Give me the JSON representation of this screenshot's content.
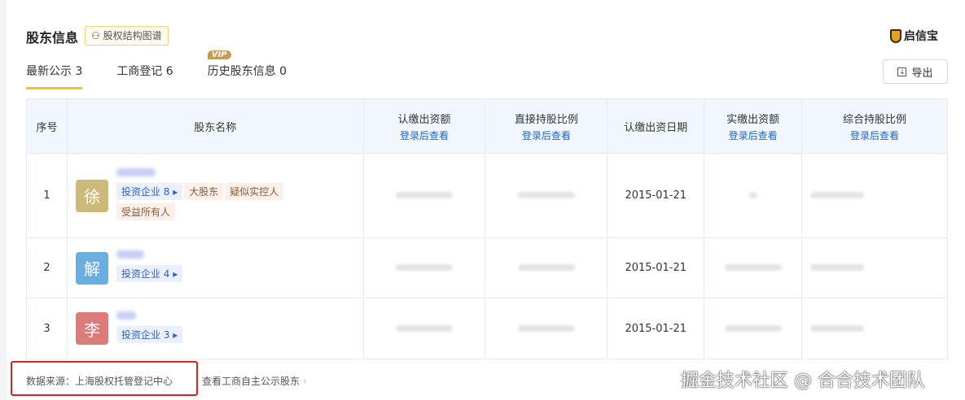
{
  "section_title": "股东信息",
  "graph_button": "股权结构图谱",
  "brand": "启信宝",
  "tabs": [
    {
      "label": "最新公示 3"
    },
    {
      "label": "工商登记 6"
    },
    {
      "label": "历史股东信息 0",
      "badge": "VIP"
    }
  ],
  "export_label": "导出",
  "columns": [
    {
      "label": "序号"
    },
    {
      "label": "股东名称"
    },
    {
      "label": "认缴出资额",
      "sub": "登录后查看"
    },
    {
      "label": "直接持股比例",
      "sub": "登录后查看"
    },
    {
      "label": "认缴出资日期"
    },
    {
      "label": "实缴出资额",
      "sub": "登录后查看"
    },
    {
      "label": "综合持股比例",
      "sub": "登录后查看"
    }
  ],
  "rows": [
    {
      "index": "1",
      "avatar": "徐",
      "avatar_color": "#cdb97a",
      "invest": "投资企业 8",
      "tags": [
        "大股东",
        "疑似实控人",
        "受益所有人"
      ],
      "date": "2015-01-21"
    },
    {
      "index": "2",
      "avatar": "解",
      "avatar_color": "#6aaedf",
      "invest": "投资企业 4",
      "tags": [],
      "date": "2015-01-21"
    },
    {
      "index": "3",
      "avatar": "李",
      "avatar_color": "#dd7a7a",
      "invest": "投资企业 3",
      "tags": [],
      "date": "2015-01-21"
    }
  ],
  "footer": {
    "source": "数据来源：上海股权托管登记中心",
    "link": "查看工商自主公示股东"
  },
  "watermark": "掘金技术社区 @ 合合技术团队"
}
